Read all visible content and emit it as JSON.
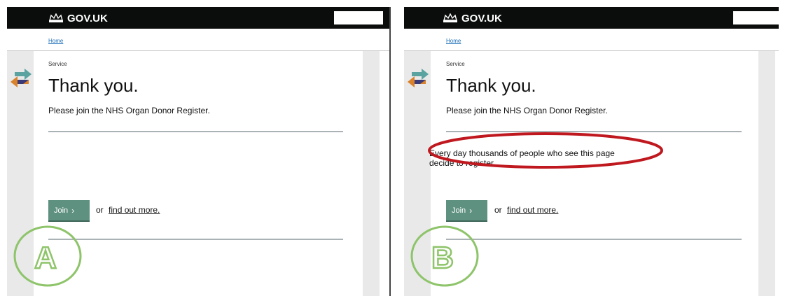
{
  "colors": {
    "header": "#0b0c0c",
    "button": "#5e9180",
    "badge_green": "#8ec46a",
    "highlight_red": "#c0181f",
    "rail_grey": "#e9e9ea"
  },
  "panels": [
    {
      "variant_label": "A",
      "header": {
        "logo_text": "GOV.UK",
        "logo_icon": "crown-icon"
      },
      "breadcrumb": {
        "home": "Home"
      },
      "service_label": "Service",
      "title": "Thank you.",
      "lede": "Please join the NHS Organ Donor Register.",
      "join_label": "Join",
      "join_icon": "chevron-right-icon",
      "or_text": "or",
      "find_more": "find out more."
    },
    {
      "variant_label": "B",
      "header": {
        "logo_text": "GOV.UK",
        "logo_icon": "crown-icon"
      },
      "breadcrumb": {
        "home": "Home"
      },
      "service_label": "Service",
      "title": "Thank you.",
      "lede": "Please join the NHS Organ Donor Register.",
      "social_norm_line1": "Every day thousands of people who see this page",
      "social_norm_line2": "decide to register.",
      "join_label": "Join",
      "join_icon": "chevron-right-icon",
      "or_text": "or",
      "find_more": "find out more."
    }
  ]
}
